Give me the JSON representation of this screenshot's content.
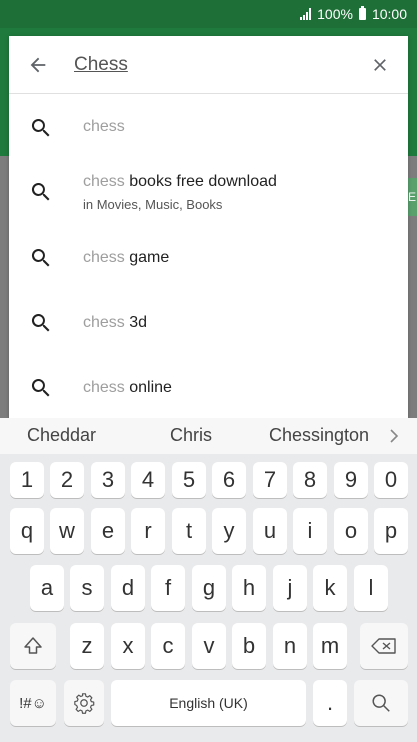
{
  "status": {
    "battery": "100%",
    "time": "10:00"
  },
  "search": {
    "query": "Chess"
  },
  "suggestions": [
    {
      "prefix": "chess",
      "suffix": ""
    },
    {
      "prefix": "chess",
      "suffix": " books free download",
      "sub": "in Movies, Music, Books"
    },
    {
      "prefix": "chess",
      "suffix": " game"
    },
    {
      "prefix": "chess",
      "suffix": " 3d"
    },
    {
      "prefix": "chess",
      "suffix": " online"
    }
  ],
  "keyboard": {
    "predictions": [
      "Cheddar",
      "Chris",
      "Chessington"
    ],
    "row_numbers": [
      "1",
      "2",
      "3",
      "4",
      "5",
      "6",
      "7",
      "8",
      "9",
      "0"
    ],
    "row1": [
      "q",
      "w",
      "e",
      "r",
      "t",
      "y",
      "u",
      "i",
      "o",
      "p"
    ],
    "row2": [
      "a",
      "s",
      "d",
      "f",
      "g",
      "h",
      "j",
      "k",
      "l"
    ],
    "row3": [
      "z",
      "x",
      "c",
      "v",
      "b",
      "n",
      "m"
    ],
    "symbols_label": "!#☺",
    "space_label": "English (UK)",
    "period_label": "."
  },
  "colors": {
    "status_bar": "#1e6f37",
    "app_bar": "#1f7a3d"
  },
  "icons": [
    "signal-icon",
    "battery-icon",
    "back-arrow-icon",
    "close-icon",
    "search-icon",
    "shift-icon",
    "backspace-icon",
    "settings-icon",
    "emoji-icon",
    "chevron-right-icon"
  ]
}
